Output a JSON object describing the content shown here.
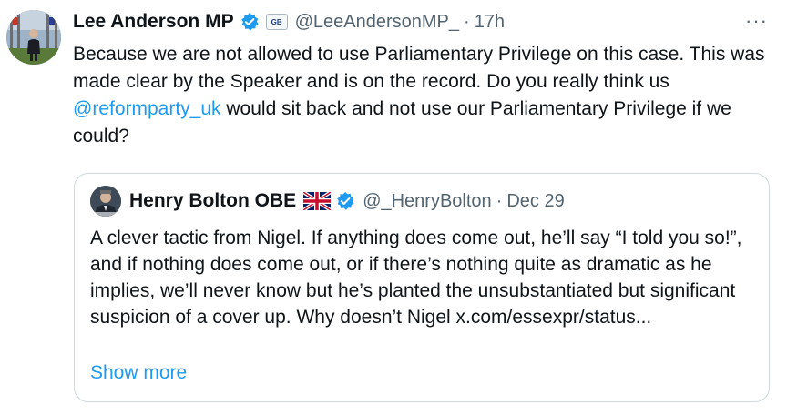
{
  "tweet": {
    "author_name": "Lee Anderson MP",
    "affiliation_badge": "GB",
    "handle": "@LeeAndersonMP_",
    "separator": "·",
    "time": "17h",
    "more_icon": "···",
    "text_1": "Because we are not allowed to use Parliamentary Privilege on this case. This was made clear by the Speaker and is on the record. Do you really think us ",
    "mention": "@reformparty_uk",
    "text_2": " would sit back and not use our Parliamentary Privilege if we could?"
  },
  "quoted": {
    "author_name": "Henry Bolton OBE",
    "handle": "@_HenryBolton",
    "separator": "·",
    "date": "Dec 29",
    "text": "A clever tactic from Nigel. If anything does come out, he’ll say “I told you so!”, and if nothing does come out, or if there’s nothing quite as dramatic as he implies, we’ll never know but he’s planted the unsubstantiated but significant suspicion of a cover up. Why doesn’t Nigel x.com/essexpr/status...",
    "show_more": "Show more"
  },
  "colors": {
    "link": "#1d9bf0",
    "verified": "#1d9bf0",
    "secondary_text": "#536471",
    "border": "#cfd9de"
  }
}
